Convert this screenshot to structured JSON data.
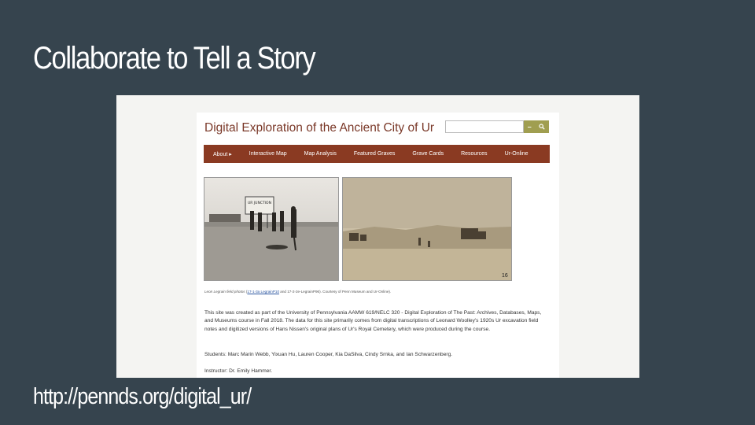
{
  "slide": {
    "title": "Collaborate to Tell a Story",
    "url": "http://pennds.org/digital_ur/"
  },
  "site": {
    "title": "Digital Exploration of the Ancient City of Ur",
    "search": {
      "placeholder": "",
      "button_icons": [
        "minus-icon",
        "search-icon"
      ]
    },
    "nav": {
      "items": [
        {
          "label": "About",
          "has_caret": true
        },
        {
          "label": "Interactive Map"
        },
        {
          "label": "Map Analysis"
        },
        {
          "label": "Featured Graves"
        },
        {
          "label": "Grave Cards"
        },
        {
          "label": "Resources"
        },
        {
          "label": "Ur-Online"
        }
      ]
    },
    "photos": {
      "photo1_sign": "UR JUNCTION",
      "photo2_number": "16"
    },
    "caption": {
      "lead": "Leon Legrain field photos",
      "open": " (",
      "link1": "17-1-3a LegrainP10",
      "middle": " and 17-2-2e-LegrainP96). Courtesy of Penn Museum and Ur-Online)."
    },
    "body": "This site was created as part of the University of Pennsylvania AAMW 619/NELC 320 - Digital Exploration of The Past: Archives, Databases, Maps, and Museums course in Fall 2018. The data for this site primarily comes from digital transcriptions of Leonard Woolley's 1920s Ur excavation field notes and digitized versions of Hans Nissen's original plans of Ur's Royal Cemetery, which were produced during the course.",
    "students": "Students: Marc Marin Webb, Yixuan Hu, Lauren Cooper, Kia DaSilva, Cindy Srnka, and Ian Schwarzenberg.",
    "instructor": "Instructor: Dr. Emily Hammer."
  },
  "colors": {
    "slide_bg": "#36444e",
    "title_text": "#7a3828",
    "nav_bg": "#8a3a22",
    "search_btn": "#a09e50",
    "link": "#2a55a0"
  }
}
